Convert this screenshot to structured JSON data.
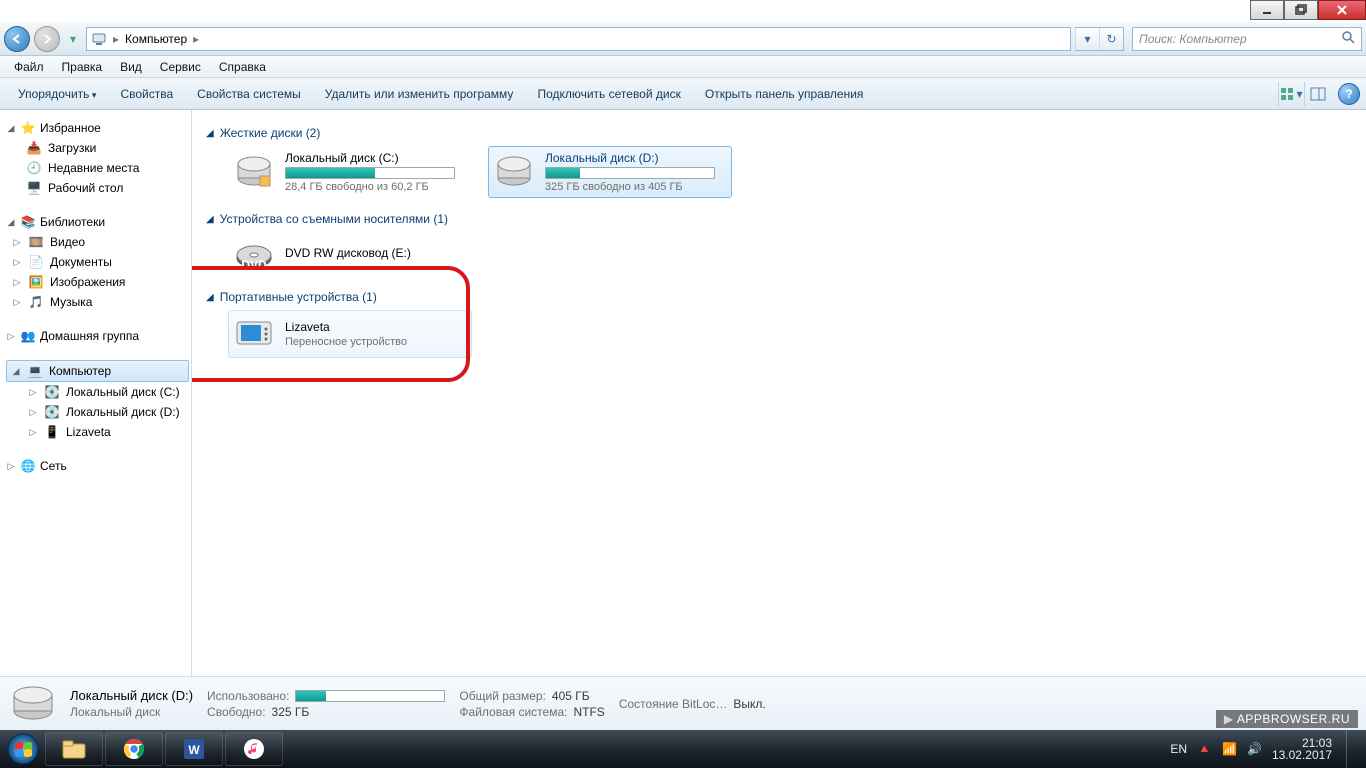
{
  "window_controls": {
    "minimize": "_",
    "maximize": "❐",
    "close": "✕"
  },
  "address": {
    "root": "Компьютер",
    "refresh": "↻"
  },
  "search": {
    "placeholder": "Поиск: Компьютер"
  },
  "menu": {
    "file": "Файл",
    "edit": "Правка",
    "view": "Вид",
    "tools": "Сервис",
    "help": "Справка"
  },
  "cmd": {
    "organize": "Упорядочить",
    "properties": "Свойства",
    "sysprops": "Свойства системы",
    "uninstall": "Удалить или изменить программу",
    "mapdrive": "Подключить сетевой диск",
    "controlpanel": "Открыть панель управления"
  },
  "nav": {
    "favorites": "Избранное",
    "downloads": "Загрузки",
    "recent": "Недавние места",
    "desktop": "Рабочий стол",
    "libraries": "Библиотеки",
    "videos": "Видео",
    "documents": "Документы",
    "pictures": "Изображения",
    "music": "Музыка",
    "homegroup": "Домашняя группа",
    "computer": "Компьютер",
    "localC": "Локальный диск (C:)",
    "localD": "Локальный диск (D:)",
    "lizaveta": "Lizaveta",
    "network": "Сеть"
  },
  "sections": {
    "hdd": "Жесткие диски (2)",
    "removable": "Устройства со съемными носителями (1)",
    "portable": "Портативные устройства (1)"
  },
  "drives": {
    "c": {
      "name": "Локальный диск (C:)",
      "free": "28,4 ГБ свободно из 60,2 ГБ",
      "fill_pct": 53
    },
    "d": {
      "name": "Локальный диск (D:)",
      "free": "325 ГБ свободно из 405 ГБ",
      "fill_pct": 20
    },
    "dvd": {
      "name": "DVD RW дисковод (E:)"
    },
    "liza": {
      "name": "Lizaveta",
      "sub": "Переносное устройство"
    }
  },
  "details": {
    "title": "Локальный диск (D:)",
    "type": "Локальный диск",
    "used_label": "Использовано:",
    "free_label": "Свободно:",
    "free_val": "325 ГБ",
    "total_label": "Общий размер:",
    "total_val": "405 ГБ",
    "fs_label": "Файловая система:",
    "fs_val": "NTFS",
    "bl_label": "Состояние BitLoc…",
    "bl_val": "Выкл.",
    "fill_pct": 20
  },
  "tray": {
    "lang": "EN",
    "time": "21:03",
    "date": "13.02.2017"
  },
  "watermark": "APPBROWSER.RU"
}
